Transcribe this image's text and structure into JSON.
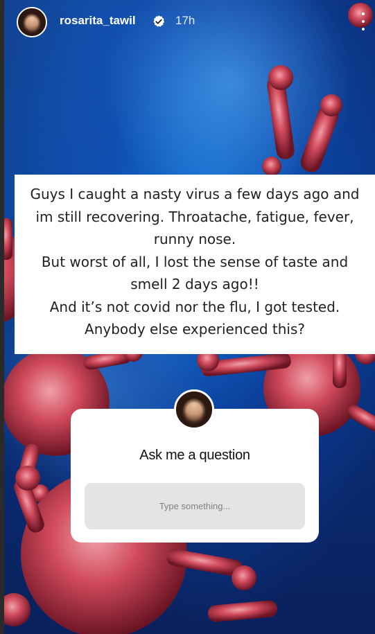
{
  "story": {
    "username": "rosarita_tawil",
    "time": "17h",
    "text": "Guys I caught a nasty virus a few days ago and im still recovering. Throatache, fatigue, fever, runny nose.\nBut worst of all, I lost the sense of taste and smell 2 days ago!!\nAnd it’s not covid nor the flu, I got tested.\nAnybody else experienced this?"
  },
  "question_sticker": {
    "title": "Ask me a question",
    "placeholder": "Type something..."
  },
  "icons": {
    "verified": "verified-badge-icon",
    "more": "more-options-icon"
  },
  "colors": {
    "background_blue": "#0a4fb0",
    "virus_red": "#c8364a",
    "sticker_input": "#e4e4e4"
  }
}
